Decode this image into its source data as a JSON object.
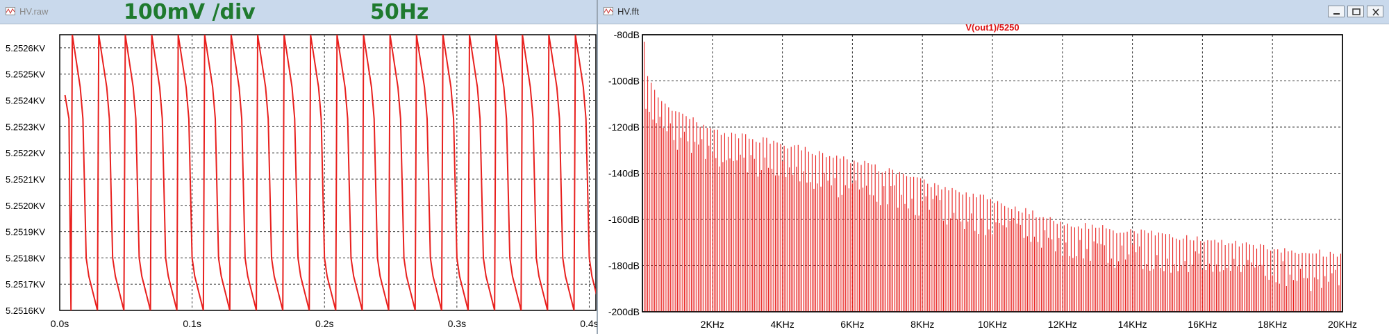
{
  "left_window": {
    "title": "HV.raw",
    "annotations": {
      "scale": "100mV /div",
      "frequency": "50Hz"
    },
    "trace_color": "#e8201e"
  },
  "right_window": {
    "title": "HV.fft",
    "trace_label": "V(out1)/5250",
    "trace_color": "#e8201e"
  },
  "chart_data": [
    {
      "type": "line",
      "xlabel": "",
      "ylabel": "",
      "x_ticks": [
        "0.0s",
        "0.1s",
        "0.2s",
        "0.3s",
        "0.4s"
      ],
      "y_ticks": [
        "5.2526KV",
        "5.2525KV",
        "5.2524KV",
        "5.2523KV",
        "5.2522KV",
        "5.2521KV",
        "5.2520KV",
        "5.2519KV",
        "5.2518KV",
        "5.2517KV",
        "5.2516KV"
      ],
      "xlim": [
        0,
        0.405
      ],
      "ylim": [
        5.2516,
        5.25265
      ],
      "grid": true,
      "series": [
        {
          "period": 0.02,
          "min": 5.2516,
          "max": 5.25265,
          "mid": 5.2524
        }
      ]
    },
    {
      "type": "bar",
      "title": "V(out1)/5250",
      "x_ticks": [
        "2KHz",
        "4KHz",
        "6KHz",
        "8KHz",
        "10KHz",
        "12KHz",
        "14KHz",
        "16KHz",
        "18KHz",
        "20KHz"
      ],
      "y_ticks": [
        "-80dB",
        "-100dB",
        "-120dB",
        "-140dB",
        "-160dB",
        "-180dB",
        "-200dB"
      ],
      "xlim": [
        0,
        20000
      ],
      "ylim": [
        -200,
        -80
      ],
      "grid": true,
      "series": [
        {
          "spacing_hz": 50,
          "envelope_x": [
            50,
            100,
            500,
            1000,
            2000,
            4000,
            6000,
            8000,
            10000,
            12000,
            14000,
            16000,
            18000,
            20000
          ],
          "envelope_db": [
            -83,
            -96,
            -106,
            -112,
            -120,
            -126,
            -133,
            -142,
            -150,
            -160,
            -164,
            -167,
            -171,
            -174
          ],
          "floor_db": -200
        }
      ]
    }
  ]
}
